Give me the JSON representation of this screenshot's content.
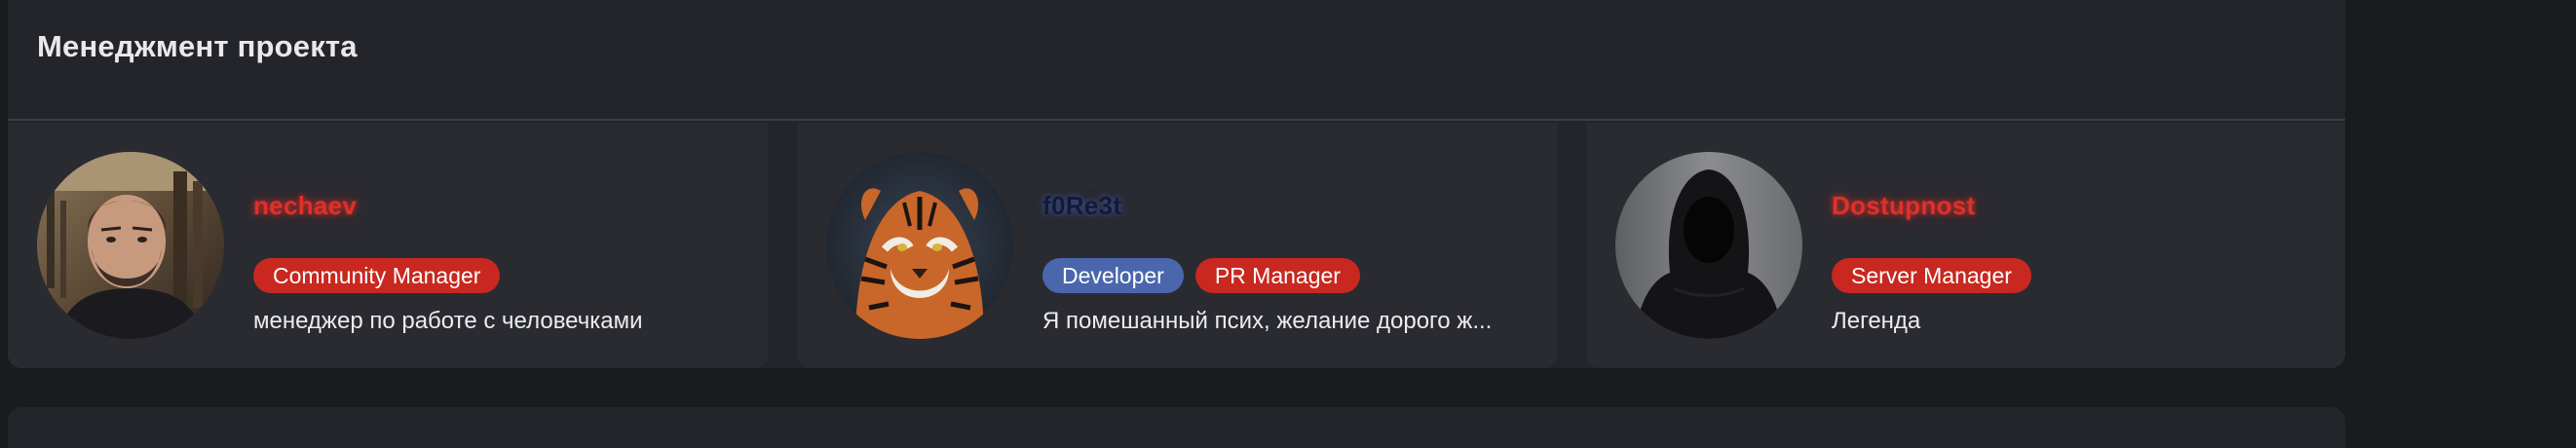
{
  "section": {
    "title": "Менеджмент проекта"
  },
  "members": [
    {
      "name": "nechaev",
      "name_color": "#e0302a",
      "avatar": "bearded-man-portrait",
      "roles": [
        {
          "label": "Community Manager",
          "color": "#c8281f"
        }
      ],
      "description": "менеджер по работе с человечками"
    },
    {
      "name": "f0Re3t",
      "name_color": "#121a3a",
      "avatar": "tiger-portrait",
      "roles": [
        {
          "label": "Developer",
          "color": "#4a67ad"
        },
        {
          "label": "PR Manager",
          "color": "#c8281f"
        }
      ],
      "description": "Я помешанный псих, желание дорого ж..."
    },
    {
      "name": "Dostupnost",
      "name_color": "#e0302a",
      "avatar": "hooded-figure-silhouette",
      "roles": [
        {
          "label": "Server Manager",
          "color": "#c8281f"
        }
      ],
      "description": "Легенда"
    }
  ]
}
